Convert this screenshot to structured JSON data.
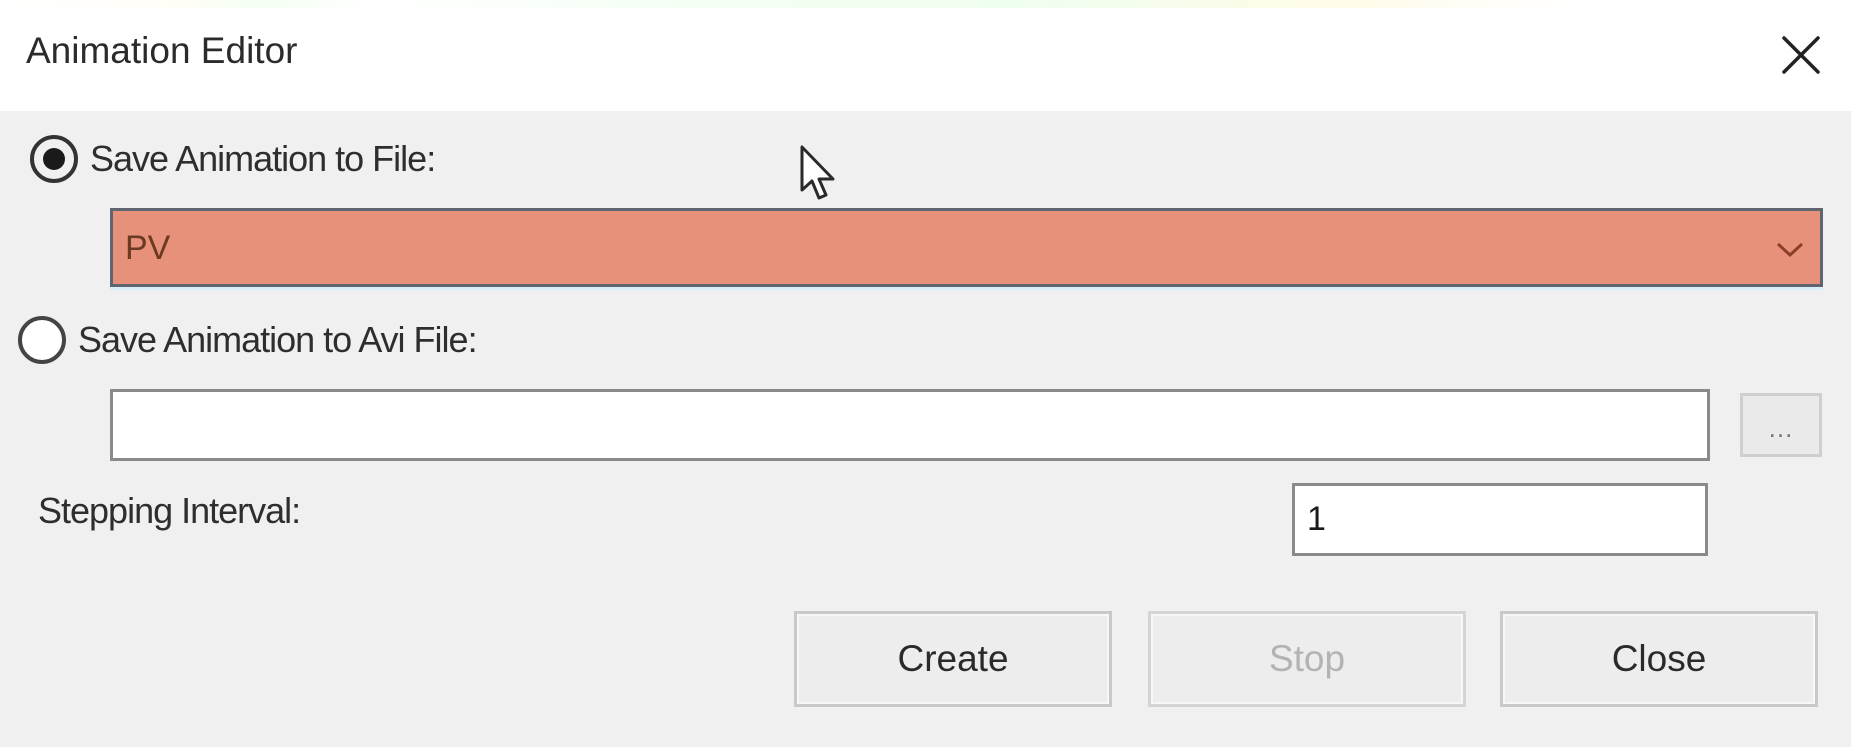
{
  "window": {
    "title": "Animation Editor",
    "close_icon": "close-x-icon"
  },
  "options": {
    "save_to_file": {
      "label": "Save Animation to File:",
      "checked": true,
      "selected_value": "PV",
      "field_color": "#e8917a",
      "dropdown_icon": "chevron-down-icon"
    },
    "save_to_avi": {
      "label": "Save Animation to Avi File:",
      "checked": false,
      "path_value": "",
      "browse_label": "..."
    }
  },
  "stepping": {
    "label": "Stepping Interval:",
    "value": "1"
  },
  "buttons": {
    "create": {
      "label": "Create",
      "enabled": true
    },
    "stop": {
      "label": "Stop",
      "enabled": false
    },
    "close": {
      "label": "Close",
      "enabled": true
    }
  },
  "cursor": {
    "icon": "mouse-pointer-icon"
  }
}
